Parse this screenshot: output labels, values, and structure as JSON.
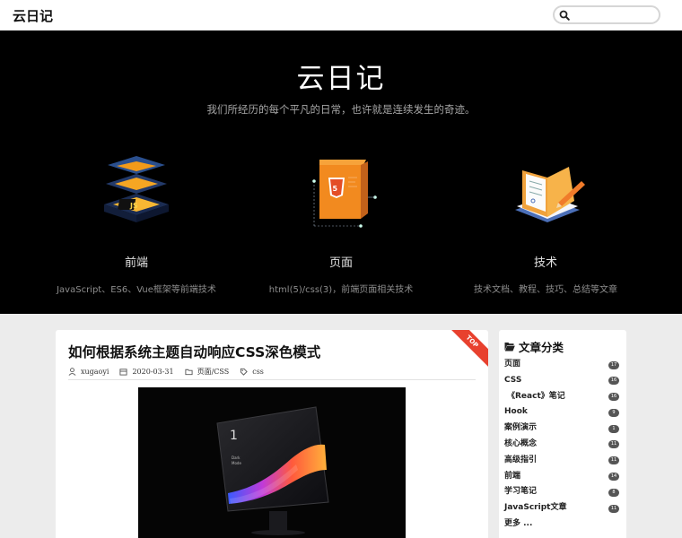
{
  "header": {
    "logo": "云日记",
    "search_placeholder": ""
  },
  "hero": {
    "title": "云日记",
    "subtitle": "我们所经历的每个平凡的日常，也许就是连续发生的奇迹。",
    "features": [
      {
        "title": "前端",
        "desc": "JavaScript、ES6、Vue框架等前端技术",
        "icon": "layers-js-icon"
      },
      {
        "title": "页面",
        "desc": "html(5)/css(3)，前端页面相关技术",
        "icon": "html5-box-icon"
      },
      {
        "title": "技术",
        "desc": "技术文档、教程、技巧、总结等文章",
        "icon": "notebook-pencil-icon"
      }
    ]
  },
  "post": {
    "ribbon": "TOP",
    "title": "如何根据系统主题自动响应CSS深色模式",
    "author": "xugaoyi",
    "date": "2020-03-31",
    "category": "页面/CSS",
    "tag": "css",
    "image_text": [
      "1",
      "Dark",
      "Mode"
    ]
  },
  "sidebar": {
    "heading": "文章分类",
    "categories": [
      {
        "name": "页面",
        "count": "17"
      },
      {
        "name": "CSS",
        "count": "16"
      },
      {
        "name": "《React》笔记",
        "count": "16"
      },
      {
        "name": "Hook",
        "count": "9"
      },
      {
        "name": "案例演示",
        "count": "1"
      },
      {
        "name": "核心概念",
        "count": "11"
      },
      {
        "name": "高级指引",
        "count": "11"
      },
      {
        "name": "前端",
        "count": "14"
      },
      {
        "name": "学习笔记",
        "count": "8"
      },
      {
        "name": "JavaScript文章",
        "count": "11"
      },
      {
        "name": "更多 ...",
        "count": ""
      }
    ]
  },
  "colors": {
    "hero_bg": "#000000",
    "ribbon": "#e8412e",
    "badge": "#555555"
  }
}
